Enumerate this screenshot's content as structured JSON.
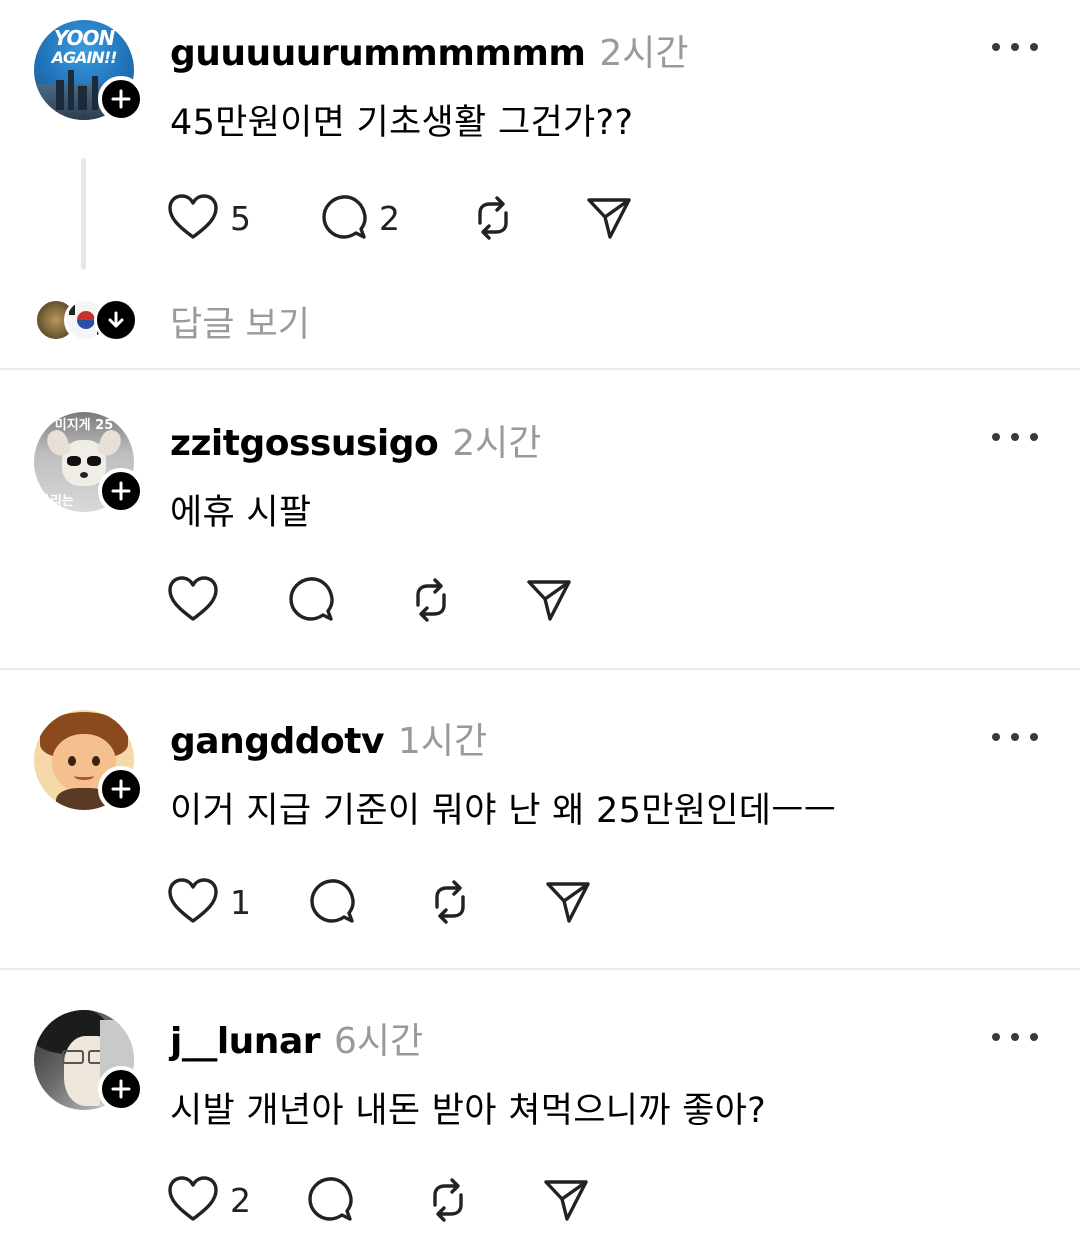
{
  "posts": [
    {
      "username": "guuuuurummmmmm",
      "time": "2시간",
      "text": "45만원이면 기초생활 그건가??",
      "likes": "5",
      "comments": "2",
      "avatar_text_1": "YOON",
      "avatar_text_2": "AGAIN!!",
      "view_replies": "답글 보기"
    },
    {
      "username": "zzitgossusigo",
      "time": "2시간",
      "text": "에휴 시팔",
      "avatar_text_1": "미지게 25",
      "avatar_text_2": "다리는"
    },
    {
      "username": "gangddotv",
      "time": "1시간",
      "text": "이거 지급 기준이 뭐야 난 왜 25만원인데ㅡㅡ",
      "likes": "1"
    },
    {
      "username": "j__lunar",
      "time": "6시간",
      "text": "시발 개년아 내돈 받아 쳐먹으니까 좋아?",
      "likes": "2"
    }
  ],
  "icons": {
    "like": "heart-icon",
    "comment": "comment-icon",
    "repost": "repost-icon",
    "share": "send-icon",
    "more": "more-icon",
    "follow": "plus-icon"
  }
}
